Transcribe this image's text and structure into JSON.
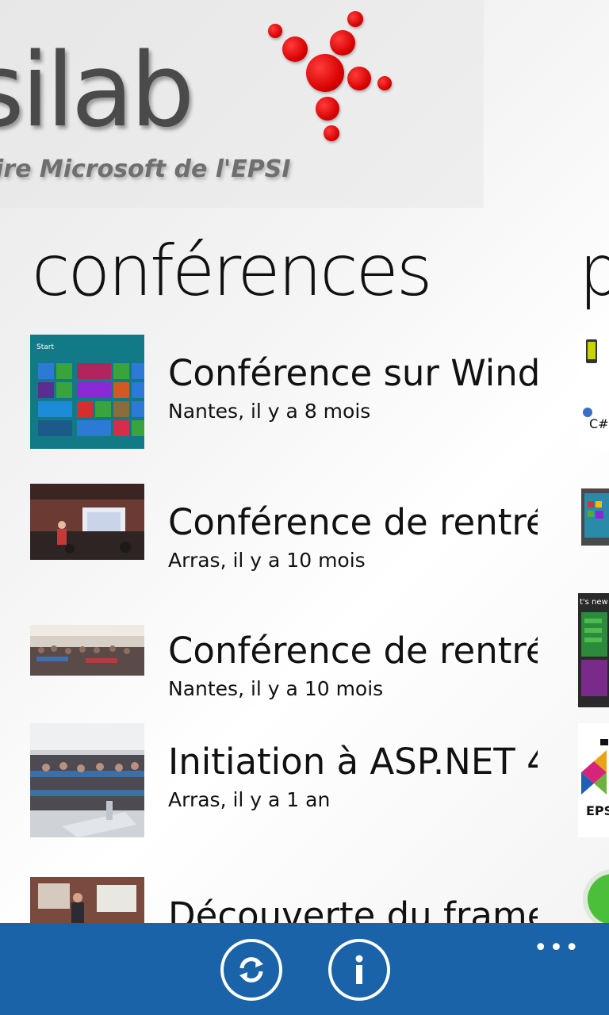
{
  "header": {
    "logo_text": "silab",
    "logo_subtitle": "ire Microsoft de l'EPSI"
  },
  "sections": [
    {
      "title": "conférences"
    },
    {
      "title": "p"
    }
  ],
  "conferences": [
    {
      "title": "Conférence sur Windows",
      "subtitle": "Nantes, il y a 8 mois"
    },
    {
      "title": "Conférence de rentrée",
      "subtitle": "Arras, il y a 10 mois"
    },
    {
      "title": "Conférence de rentrée",
      "subtitle": "Nantes, il y a 10 mois"
    },
    {
      "title": "Initiation à ASP.NET 4",
      "subtitle": "Arras, il y a 1 an"
    },
    {
      "title": "Découverte du framework",
      "subtitle": ""
    }
  ],
  "right_column_snippets": {
    "csharp_label": "C#",
    "epsi_label": "EPS",
    "whats_new": "t's new a"
  },
  "appbar": {
    "refresh_icon": "refresh-icon",
    "info_icon": "info-icon",
    "more_label": "•••"
  },
  "colors": {
    "appbar": "#1a63a8",
    "accent_red": "#d60000"
  }
}
